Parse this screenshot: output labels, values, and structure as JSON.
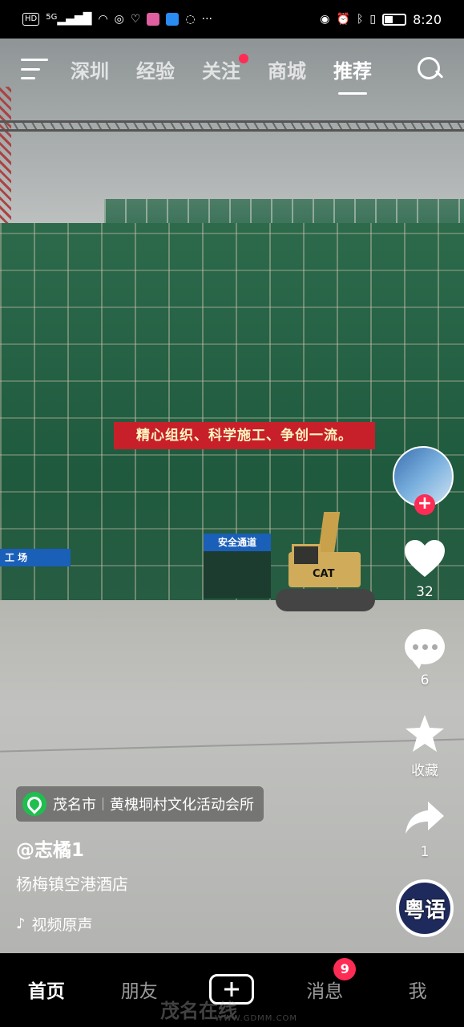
{
  "status_bar": {
    "hd": "HD",
    "signal": "5G",
    "time": "8:20",
    "left_icons": [
      "hd-icon",
      "signal-icon",
      "wifi-icon",
      "jdm-icon",
      "app-icon",
      "app-icon",
      "app-icon",
      "chat-icon",
      "more-icon"
    ],
    "right_icons": [
      "eye-icon",
      "alarm-icon",
      "bluetooth-icon",
      "vibrate-icon",
      "battery-icon"
    ]
  },
  "top_nav": {
    "tabs": [
      {
        "label": "深圳",
        "active": false,
        "dot": false
      },
      {
        "label": "经验",
        "active": false,
        "dot": false
      },
      {
        "label": "关注",
        "active": false,
        "dot": true
      },
      {
        "label": "商城",
        "active": false,
        "dot": false
      },
      {
        "label": "推荐",
        "active": true,
        "dot": false
      }
    ]
  },
  "scene": {
    "banner": "精心组织、科学施工、争创一流。",
    "entrance_sign": "安全通道",
    "left_sign": "工 场",
    "excavator_brand": "CAT"
  },
  "side_actions": {
    "follow": "+",
    "like_count": "32",
    "comment_count": "6",
    "favorite_label": "收藏",
    "share_count": "1",
    "music_disc_text": "粤语",
    "accent": "#fe2c55"
  },
  "video_info": {
    "location_city": "茂名市",
    "location_place": "黄槐垌村文化活动会所",
    "author": "@志橘1",
    "description": "杨梅镇空港酒店",
    "sound": "视频原声"
  },
  "tab_bar": {
    "home": "首页",
    "friends": "朋友",
    "messages": "消息",
    "messages_badge": "9",
    "me": "我"
  },
  "watermark": {
    "logo": "茂名在线",
    "url": "WWW.GDMM.COM"
  }
}
